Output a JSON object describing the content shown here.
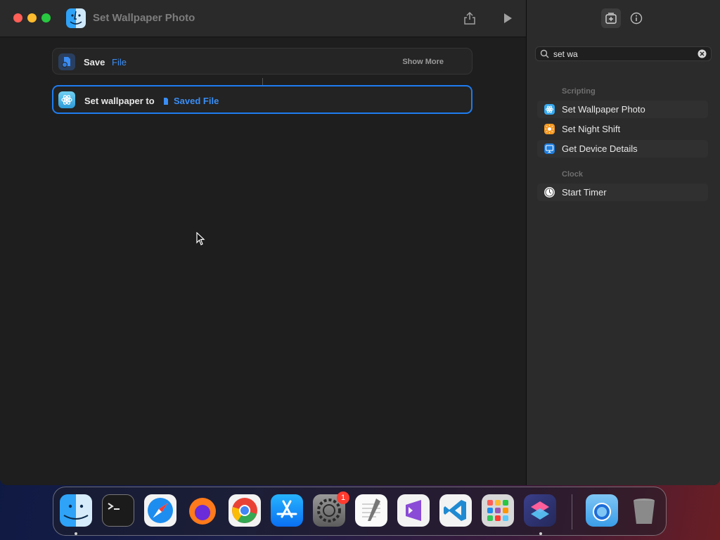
{
  "window": {
    "title": "Set Wallpaper Photo"
  },
  "editor": {
    "actions": [
      {
        "label": "Save",
        "token": "File",
        "show_more": "Show More"
      },
      {
        "label": "Set wallpaper to",
        "token": "Saved File"
      }
    ]
  },
  "sidebar": {
    "search": {
      "value": "set wa"
    },
    "sections": [
      {
        "header": "Scripting",
        "items": [
          {
            "label": "Set Wallpaper Photo",
            "icon": "wallpaper-icon",
            "color": "#36a9f0"
          },
          {
            "label": "Set Night Shift",
            "icon": "sun-icon",
            "color": "#f59a23"
          },
          {
            "label": "Get Device Details",
            "icon": "monitor-icon",
            "color": "#1f7fe0"
          }
        ]
      },
      {
        "header": "Clock",
        "items": [
          {
            "label": "Start Timer",
            "icon": "timer-icon",
            "color": "#e8e8e8"
          }
        ]
      }
    ]
  },
  "dock": {
    "apps": [
      "Finder",
      "Terminal",
      "Safari",
      "Firefox",
      "Chrome",
      "App Store",
      "System Settings",
      "TextEdit",
      "Visual Studio",
      "VS Code",
      "Launchpad",
      "Shortcuts",
      "Downloads",
      "Trash"
    ],
    "settings_badge": "1"
  },
  "colors": {
    "accent": "#1e7cf0",
    "token": "#3a8ef5"
  }
}
